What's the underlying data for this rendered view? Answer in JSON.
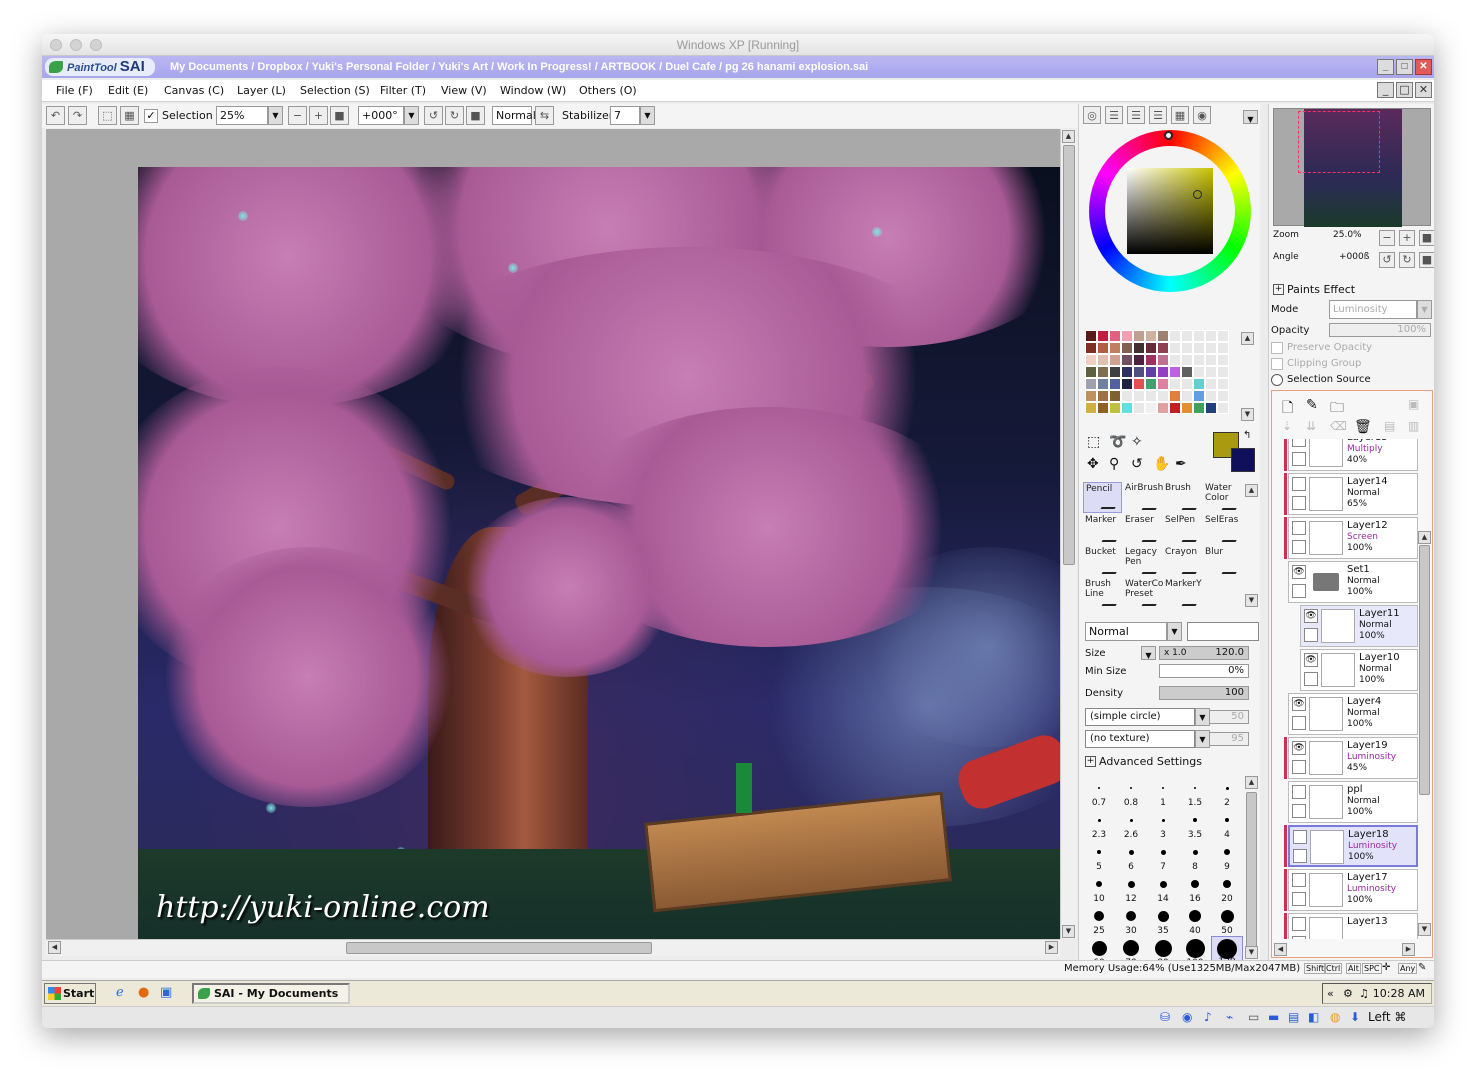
{
  "host": {
    "title": "Windows XP [Running]",
    "host_key": "Left ⌘"
  },
  "app": {
    "logo_text": "PaintTool",
    "logo_brand": "SAI",
    "path": "My Documents / Dropbox / Yuki's Personal Folder / Yuki's Art / Work In Progress! / ARTBOOK / Duel Cafe / pg 26 hanami explosion.sai"
  },
  "menu": [
    "File (F)",
    "Edit (E)",
    "Canvas (C)",
    "Layer (L)",
    "Selection (S)",
    "Filter (T)",
    "View (V)",
    "Window (W)",
    "Others (O)"
  ],
  "toolbar": {
    "selection_label": "Selection",
    "zoom": "25%",
    "angle": "+000°",
    "blend": "Normal",
    "stabilizer_label": "Stabilizer",
    "stabilizer": "7"
  },
  "canvas": {
    "watermark": "http://yuki-online.com"
  },
  "color_panel": {
    "swatches": [
      "#5a1a1a",
      "#c02040",
      "#e06080",
      "#f0a0b0",
      "#c0a090",
      "#d0b0a0",
      "#a08070",
      "#e8e8e8",
      "#e8e8e8",
      "#e8e8e8",
      "#e8e8e8",
      "#e8e8e8",
      "#803020",
      "#b06040",
      "#c08060",
      "#806050",
      "#403030",
      "#6a2a3a",
      "#904050",
      "#e8e8e8",
      "#e8e8e8",
      "#e8e8e8",
      "#e8e8e8",
      "#e8e8e8",
      "#f0d0c0",
      "#e0c0b0",
      "#d0a090",
      "#705060",
      "#502040",
      "#a03060",
      "#c07090",
      "#e8e8e8",
      "#e8e8e8",
      "#e8e8e8",
      "#e8e8e8",
      "#e8e8e8",
      "#606040",
      "#807050",
      "#404040",
      "#303060",
      "#505080",
      "#6040a0",
      "#9040c0",
      "#c060e0",
      "#606060",
      "#e8e8e8",
      "#e8e8e8",
      "#e8e8e8",
      "#a0a0b0",
      "#7080a0",
      "#5060a0",
      "#202040",
      "#e05050",
      "#40a070",
      "#e080a0",
      "#e8e8e8",
      "#e8e8e8",
      "#60d0d0",
      "#e8e8e8",
      "#e8e8e8",
      "#c09060",
      "#a07040",
      "#806030",
      "#e8e8e8",
      "#e8e8e8",
      "#e8e8e8",
      "#e8e8e8",
      "#e08040",
      "#e8e8e8",
      "#60a0e0",
      "#e8e8e8",
      "#e8e8e8",
      "#d0b040",
      "#906020",
      "#c0c040",
      "#60e0e0",
      "#e8e8e8",
      "#f0f0f0",
      "#e0a0a0",
      "#c02020",
      "#e09030",
      "#40a060",
      "#204080",
      "#e8e8e8"
    ],
    "primary": "#aa9a10",
    "secondary": "#10105a"
  },
  "tools": [
    {
      "name": "Pencil",
      "sel": true
    },
    {
      "name": "AirBrush"
    },
    {
      "name": "Brush"
    },
    {
      "name": "Water Color"
    },
    {
      "name": "Marker"
    },
    {
      "name": "Eraser"
    },
    {
      "name": "SelPen"
    },
    {
      "name": "SelEras"
    },
    {
      "name": "Bucket"
    },
    {
      "name": "Legacy Pen"
    },
    {
      "name": "Crayon"
    },
    {
      "name": "Blur"
    },
    {
      "name": "Brush Line"
    },
    {
      "name": "WaterCo Preset"
    },
    {
      "name": "MarkerY"
    },
    {
      "name": ""
    }
  ],
  "brush": {
    "blend": "Normal",
    "size_label": "Size",
    "size_mult": "x 1.0",
    "size": "120.0",
    "min_size_label": "Min Size",
    "min_size": "0%",
    "density_label": "Density",
    "density": "100",
    "shape": "(simple circle)",
    "shape_value": "50",
    "texture": "(no texture)",
    "texture_value": "95",
    "advanced": "Advanced Settings"
  },
  "brush_sizes": [
    "0.7",
    "0.8",
    "1",
    "1.5",
    "2",
    "2.3",
    "2.6",
    "3",
    "3.5",
    "4",
    "5",
    "6",
    "7",
    "8",
    "9",
    "10",
    "12",
    "14",
    "16",
    "20",
    "25",
    "30",
    "35",
    "40",
    "50",
    "60",
    "70",
    "80",
    "100",
    "120"
  ],
  "navigator": {
    "zoom_label": "Zoom",
    "zoom": "25.0%",
    "angle_label": "Angle",
    "angle": "+000ß"
  },
  "layer_props": {
    "paints_effect": "Paints Effect",
    "mode_label": "Mode",
    "mode": "Luminosity",
    "opacity_label": "Opacity",
    "opacity": "100%",
    "preserve_opacity": "Preserve Opacity",
    "clipping_group": "Clipping Group",
    "selection_source": "Selection Source"
  },
  "layers": [
    {
      "name": "Layer15",
      "mode": "Multiply",
      "opacity": "40%",
      "mode_color": "#9a2aa0",
      "red": true
    },
    {
      "name": "Layer14",
      "mode": "Normal",
      "opacity": "65%",
      "mode_color": "#111111",
      "red": true
    },
    {
      "name": "Layer12",
      "mode": "Screen",
      "opacity": "100%",
      "mode_color": "#9a2aa0",
      "red": true
    },
    {
      "name": "Set1",
      "mode": "Normal",
      "opacity": "100%",
      "mode_color": "#111111",
      "eye": true,
      "folder": true
    },
    {
      "name": "Layer11",
      "mode": "Normal",
      "opacity": "100%",
      "mode_color": "#111111",
      "eye": true,
      "indent": true,
      "hover": true
    },
    {
      "name": "Layer10",
      "mode": "Normal",
      "opacity": "100%",
      "mode_color": "#111111",
      "eye": true,
      "indent": true
    },
    {
      "name": "Layer4",
      "mode": "Normal",
      "opacity": "100%",
      "mode_color": "#111111",
      "eye": true
    },
    {
      "name": "Layer19",
      "mode": "Luminosity",
      "opacity": "45%",
      "mode_color": "#9a2aa0",
      "eye": true,
      "red": true
    },
    {
      "name": "ppl",
      "mode": "Normal",
      "opacity": "100%",
      "mode_color": "#111111"
    },
    {
      "name": "Layer18",
      "mode": "Luminosity",
      "opacity": "100%",
      "mode_color": "#9a2aa0",
      "active": true,
      "red": true
    },
    {
      "name": "Layer17",
      "mode": "Luminosity",
      "opacity": "100%",
      "mode_color": "#9a2aa0",
      "red": true
    },
    {
      "name": "Layer13",
      "mode": "",
      "opacity": "",
      "mode_color": "#111111",
      "red": true
    }
  ],
  "status": {
    "memory": "Memory Usage:64% (Use1325MB/Max2047MB)",
    "keys": [
      "Shift",
      "Ctrl",
      "Alt",
      "SPC",
      "Any"
    ]
  },
  "taskbar": {
    "start": "Start",
    "task": "SAI - My Documents ...",
    "clock": "10:28 AM",
    "chevron": "«"
  }
}
